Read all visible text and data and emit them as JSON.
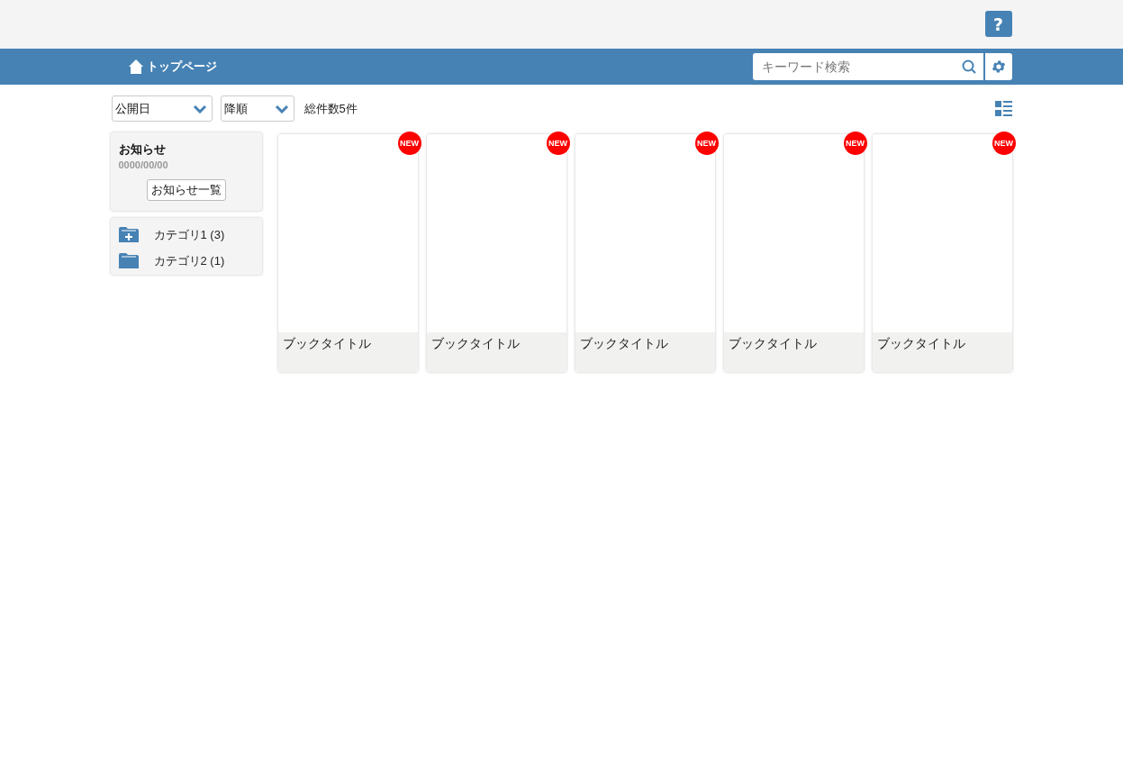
{
  "help_button": {
    "label": "?"
  },
  "navbar": {
    "home_link": "トップページ",
    "search": {
      "placeholder": "キーワード検索"
    }
  },
  "toolbar": {
    "sort_field": "公開日",
    "sort_order": "降順",
    "total": "総件数5件"
  },
  "notice": {
    "title": "お知らせ",
    "date": "0000/00/00",
    "button": "お知らせ一覧"
  },
  "categories": [
    {
      "kind": "expandable",
      "label": "カテゴリ1 (3)"
    },
    {
      "kind": "plain",
      "label": "カテゴリ2 (1)"
    }
  ],
  "books": [
    {
      "title": "ブックタイトル",
      "badge": "NEW"
    },
    {
      "title": "ブックタイトル",
      "badge": "NEW"
    },
    {
      "title": "ブックタイトル",
      "badge": "NEW"
    },
    {
      "title": "ブックタイトル",
      "badge": "NEW"
    },
    {
      "title": "ブックタイトル",
      "badge": "NEW"
    }
  ]
}
